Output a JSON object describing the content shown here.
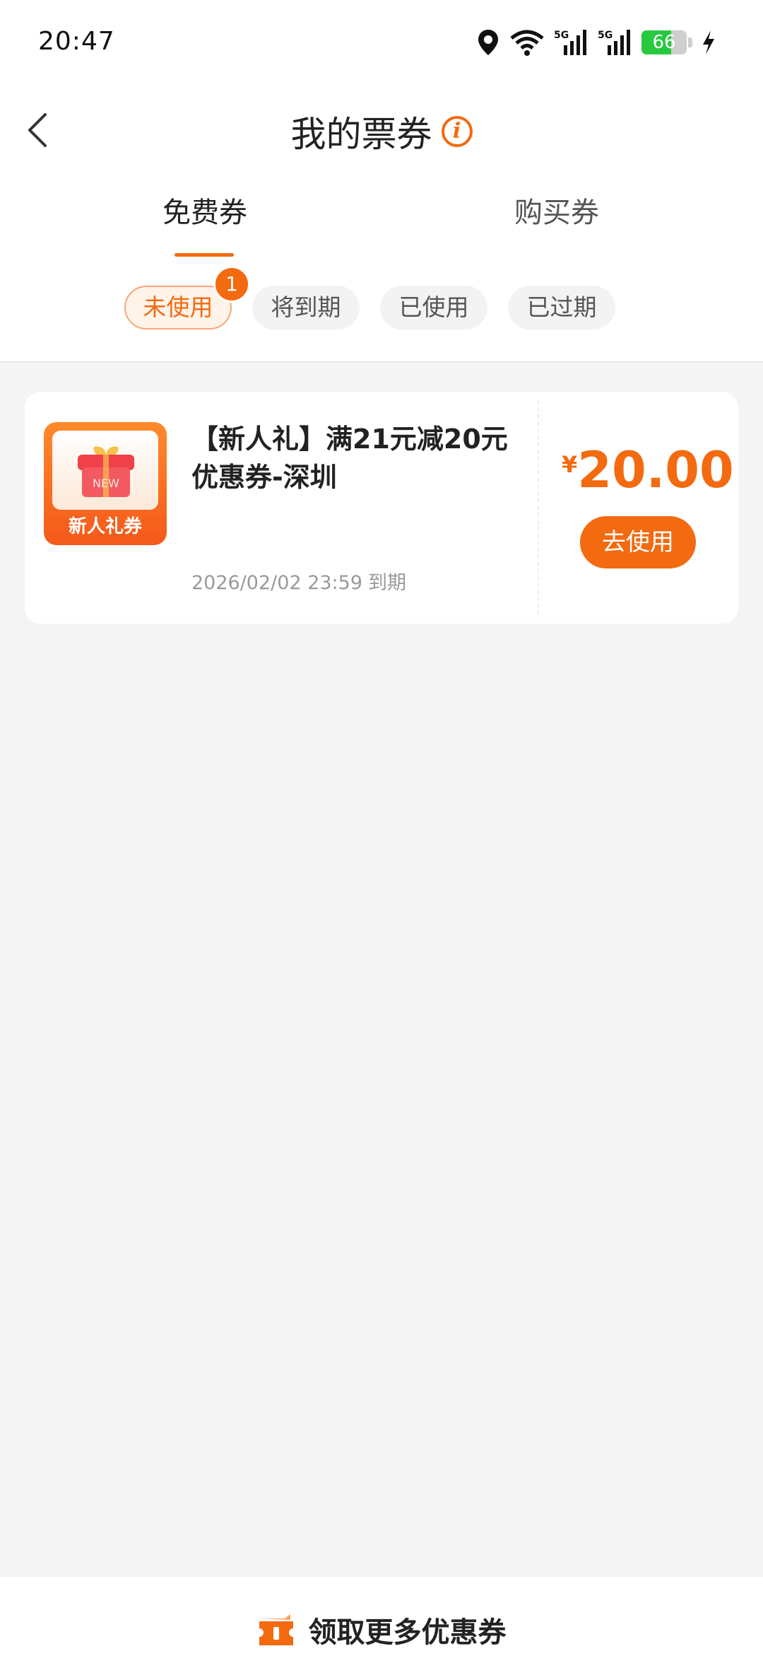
{
  "status_bar": {
    "time": "20:47",
    "network_1": "5G",
    "network_2": "5G",
    "battery_level": "66"
  },
  "header": {
    "title": "我的票券",
    "info_icon": "info-icon"
  },
  "main_tabs": [
    {
      "label": "免费券",
      "active": true
    },
    {
      "label": "购买券",
      "active": false
    }
  ],
  "filter_chips": [
    {
      "label": "未使用",
      "active": true,
      "badge": "1"
    },
    {
      "label": "将到期",
      "active": false
    },
    {
      "label": "已使用",
      "active": false
    },
    {
      "label": "已过期",
      "active": false
    }
  ],
  "coupons": [
    {
      "image_caption": "新人礼券",
      "image_badge": "NEW",
      "title": "【新人礼】满21元减20元优惠券-深圳",
      "expiry_date": "2026/02/02 23:59",
      "expiry_suffix": "到期",
      "currency": "¥",
      "amount": "20.00",
      "action_label": "去使用"
    }
  ],
  "bottom": {
    "action_label": "领取更多优惠券"
  },
  "colors": {
    "accent": "#f36a10",
    "background": "#f4f4f5"
  }
}
